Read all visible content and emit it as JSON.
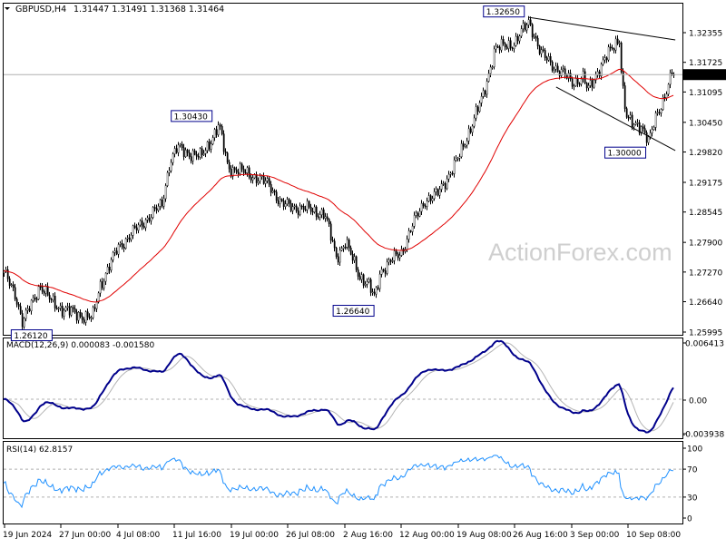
{
  "header": {
    "symbol_label": "GBPUSD,H4",
    "ohlc": "1.31447 1.31491 1.31368 1.31464",
    "menu_icon": "triangle-down-icon"
  },
  "watermark": "ActionForex.com",
  "colors": {
    "candles": "#000000",
    "moving_average": "#e00000",
    "macd_line": "#00008b",
    "signal_line": "#b4b4b4",
    "rsi_line": "#1e90ff",
    "current_price_bg": "#000000"
  },
  "chart_data": [
    {
      "type": "candlestick",
      "title": "GBPUSD,H4",
      "y_ticks": [
        "1.32355",
        "1.31725",
        "1.31095",
        "1.30450",
        "1.29820",
        "1.29175",
        "1.28545",
        "1.27900",
        "1.27270",
        "1.26640",
        "1.25995"
      ],
      "ylim": [
        1.25995,
        1.32355
      ],
      "current_price": "1.31464",
      "x_ticks": [
        {
          "label": "19 Jun 2024",
          "date": "2024-06-19T00:00"
        },
        {
          "label": "27 Jun 00:00",
          "date": "2024-06-27T00:00"
        },
        {
          "label": "4 Jul 08:00",
          "date": "2024-07-04T08:00"
        },
        {
          "label": "11 Jul 16:00",
          "date": "2024-07-11T16:00"
        },
        {
          "label": "19 Jul 00:00",
          "date": "2024-07-19T00:00"
        },
        {
          "label": "26 Jul 08:00",
          "date": "2024-07-26T08:00"
        },
        {
          "label": "2 Aug 16:00",
          "date": "2024-08-02T16:00"
        },
        {
          "label": "12 Aug 00:00",
          "date": "2024-08-12T00:00"
        },
        {
          "label": "19 Aug 08:00",
          "date": "2024-08-19T08:00"
        },
        {
          "label": "26 Aug 16:00",
          "date": "2024-08-26T16:00"
        },
        {
          "label": "3 Sep 00:00",
          "date": "2024-09-03T00:00"
        },
        {
          "label": "10 Sep 08:00",
          "date": "2024-09-10T08:00"
        }
      ],
      "price_path": [
        [
          "2024-06-18T20:00",
          1.2725
        ],
        [
          "2024-06-20T12:00",
          1.268
        ],
        [
          "2024-06-21T12:00",
          1.2618
        ],
        [
          "2024-06-24T00:00",
          1.27
        ],
        [
          "2024-06-25T12:00",
          1.2665
        ],
        [
          "2024-06-27T00:00",
          1.265
        ],
        [
          "2024-06-28T12:00",
          1.264
        ],
        [
          "2024-07-01T00:00",
          1.2628
        ],
        [
          "2024-07-02T00:00",
          1.27
        ],
        [
          "2024-07-04T08:00",
          1.278
        ],
        [
          "2024-07-08T00:00",
          1.284
        ],
        [
          "2024-07-10T00:00",
          1.287
        ],
        [
          "2024-07-11T00:00",
          1.296
        ],
        [
          "2024-07-12T00:00",
          1.299
        ],
        [
          "2024-07-15T00:00",
          1.297
        ],
        [
          "2024-07-17T08:00",
          1.3038
        ],
        [
          "2024-07-18T12:00",
          1.295
        ],
        [
          "2024-07-22T00:00",
          1.293
        ],
        [
          "2024-07-24T00:00",
          1.291
        ],
        [
          "2024-07-25T12:00",
          1.287
        ],
        [
          "2024-07-29T00:00",
          1.286
        ],
        [
          "2024-07-31T00:00",
          1.285
        ],
        [
          "2024-08-01T12:00",
          1.276
        ],
        [
          "2024-08-02T16:00",
          1.279
        ],
        [
          "2024-08-05T00:00",
          1.272
        ],
        [
          "2024-08-06T12:00",
          1.27
        ],
        [
          "2024-08-07T12:00",
          1.267
        ],
        [
          "2024-08-08T12:00",
          1.273
        ],
        [
          "2024-08-12T00:00",
          1.277
        ],
        [
          "2024-08-13T12:00",
          1.283
        ],
        [
          "2024-08-15T00:00",
          1.288
        ],
        [
          "2024-08-16T12:00",
          1.289
        ],
        [
          "2024-08-19T08:00",
          1.297
        ],
        [
          "2024-08-21T00:00",
          1.304
        ],
        [
          "2024-08-22T12:00",
          1.31
        ],
        [
          "2024-08-24T00:00",
          1.32
        ],
        [
          "2024-08-26T16:00",
          1.3215
        ],
        [
          "2024-08-28T12:00",
          1.326
        ],
        [
          "2024-08-30T00:00",
          1.319
        ],
        [
          "2024-09-03T00:00",
          1.313
        ],
        [
          "2024-09-04T12:00",
          1.314
        ],
        [
          "2024-09-05T00:00",
          1.311
        ],
        [
          "2024-09-06T12:00",
          1.316
        ],
        [
          "2024-09-09T04:00",
          1.3225
        ],
        [
          "2024-09-09T12:00",
          1.313
        ],
        [
          "2024-09-10T00:00",
          1.306
        ],
        [
          "2024-09-10T16:00",
          1.304
        ],
        [
          "2024-09-12T00:00",
          1.304
        ],
        [
          "2024-09-13T00:00",
          1.3002
        ],
        [
          "2024-09-14T00:00",
          1.306
        ],
        [
          "2024-09-15T00:00",
          1.31
        ],
        [
          "2024-09-16T00:00",
          1.31464
        ]
      ],
      "annotations": [
        {
          "label": "1.26120",
          "date": "2024-06-21T12:00",
          "price": 1.2612
        },
        {
          "label": "1.30430",
          "date": "2024-07-17T08:00",
          "price": 1.3043
        },
        {
          "label": "1.26640",
          "date": "2024-08-07T12:00",
          "price": 1.2664
        },
        {
          "label": "1.32650",
          "date": "2024-08-28T12:00",
          "price": 1.3265
        },
        {
          "label": "1.30000",
          "date": "2024-09-13T00:00",
          "price": 1.3
        }
      ],
      "trendlines": [
        {
          "from": [
            "2024-08-28T12:00",
            1.3268
          ],
          "to": [
            "2024-09-16T12:00",
            1.322
          ]
        },
        {
          "from": [
            "2024-09-01T00:00",
            1.312
          ],
          "to": [
            "2024-09-16T12:00",
            1.2985
          ]
        }
      ],
      "moving_average_period": 55
    },
    {
      "type": "line",
      "title": "MACD(12,26,9) 0.000083 -0.001580",
      "y_ticks": [
        "0.006413",
        "0.00",
        "-0.003938"
      ],
      "ylim": [
        -0.003938,
        0.006413
      ]
    },
    {
      "type": "line",
      "title": "RSI(14) 62.8157",
      "y_ticks": [
        "100",
        "70",
        "30",
        "0"
      ],
      "ylim": [
        0,
        100
      ],
      "levels": [
        70,
        30
      ]
    }
  ]
}
